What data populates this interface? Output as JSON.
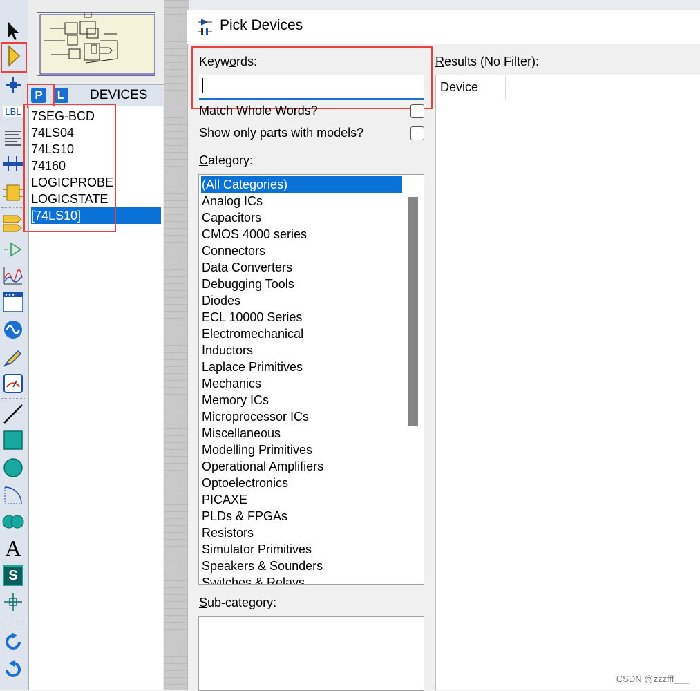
{
  "dialog": {
    "title": "Pick Devices",
    "keywords_label": "Keywords:",
    "keywords_value": "",
    "match_whole_words_label": "Match Whole Words?",
    "show_models_label": "Show only parts with models?",
    "category_label": "Category:",
    "categories": [
      "(All Categories)",
      "Analog ICs",
      "Capacitors",
      "CMOS 4000 series",
      "Connectors",
      "Data Converters",
      "Debugging Tools",
      "Diodes",
      "ECL 10000 Series",
      "Electromechanical",
      "Inductors",
      "Laplace Primitives",
      "Mechanics",
      "Memory ICs",
      "Microprocessor ICs",
      "Miscellaneous",
      "Modelling Primitives",
      "Operational Amplifiers",
      "Optoelectronics",
      "PICAXE",
      "PLDs & FPGAs",
      "Resistors",
      "Simulator Primitives",
      "Speakers & Sounders",
      "Switches & Relays"
    ],
    "selected_category": "(All Categories)",
    "subcategory_label": "Sub-category:",
    "results_label": "Results (No Filter):",
    "results_column": "Device"
  },
  "devices_panel": {
    "p_button": "P",
    "l_button": "L",
    "header": "DEVICES",
    "items": [
      "7SEG-BCD",
      "74LS04",
      "74LS10",
      "74160",
      "LOGICPROBE",
      "LOGICSTATE",
      "[74LS10]"
    ],
    "selected_item": "[74LS10]"
  },
  "toolbar": {
    "tools": [
      "selection-mode-icon",
      "component-mode-icon",
      "junction-dot-icon",
      "wire-label-icon",
      "text-script-icon",
      "buses-icon",
      "subcircuit-icon",
      "terminals-icon",
      "device-pins-icon",
      "graph-icon",
      "tape-recorder-icon",
      "generator-icon",
      "voltage-probe-icon",
      "virtual-instruments-icon",
      "line-icon",
      "box-icon",
      "circle-icon",
      "arc-icon",
      "closed-path-icon",
      "text-icon",
      "symbol-icon",
      "marker-icon",
      "rotate-clockwise-icon",
      "rotate-anticlockwise-icon"
    ],
    "lbl_text": "LBL",
    "text_tool": "A",
    "symbol_tool": "S"
  },
  "colors": {
    "highlight": "#e8423e",
    "selection": "#0a72d6",
    "accent": "#1a6fd1"
  },
  "watermark": "CSDN @zzzfff___"
}
